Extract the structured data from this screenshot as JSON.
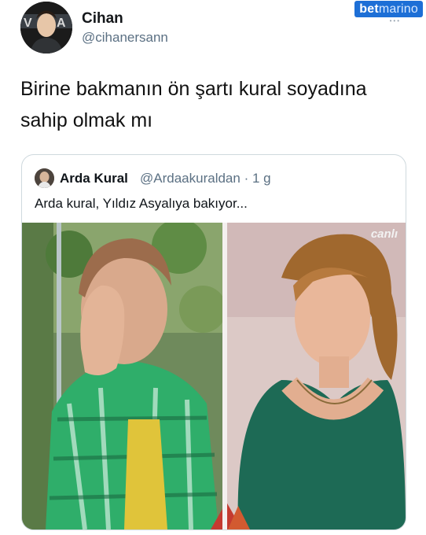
{
  "tweet": {
    "author": {
      "display_name": "Cihan",
      "handle": "@cihanersann"
    },
    "text": "Birine bakmanın ön şartı kural soyadına sahip olmak mı"
  },
  "brand": {
    "name_bold": "bet",
    "name_light": "marino",
    "color": "#1d6fd6"
  },
  "quoted_tweet": {
    "author": {
      "display_name": "Arda Kural",
      "handle": "@Ardaakuraldan",
      "time": "· 1 g"
    },
    "text": "Arda kural, Yıldız Asyalıya bakıyor...",
    "media": {
      "live_tag": "canlı"
    }
  },
  "colors": {
    "secondary_text": "#5b7083",
    "border": "#cfd9de",
    "shirt_green": "#2fae6a",
    "top_green": "#1d6a55"
  }
}
